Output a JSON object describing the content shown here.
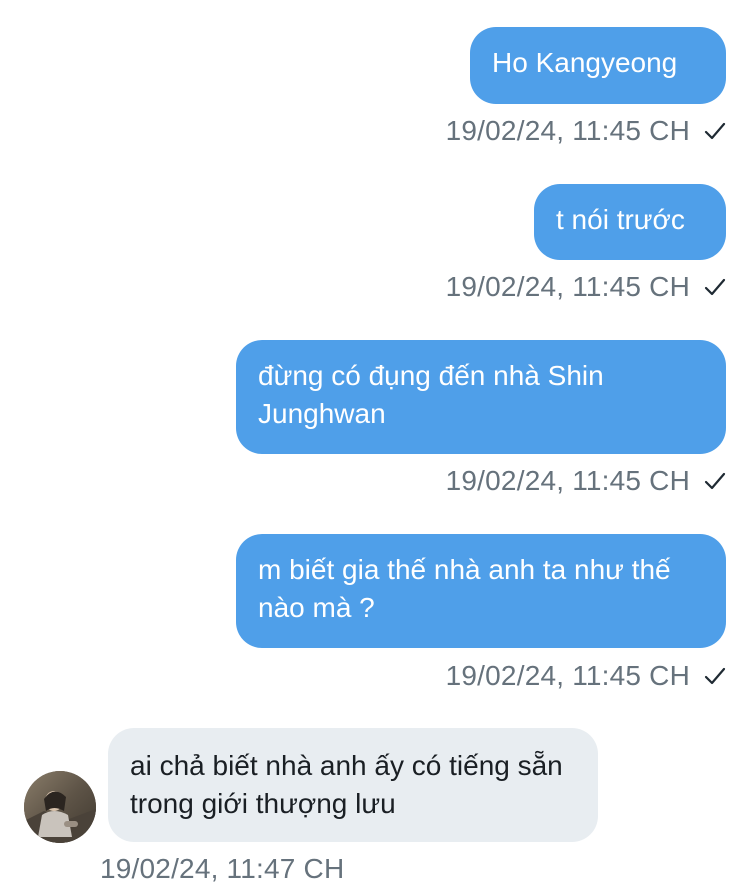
{
  "messages": [
    {
      "direction": "outgoing",
      "text": "Ho Kangyeong",
      "timestamp": "19/02/24, 11:45 CH",
      "status_icon": "check-icon"
    },
    {
      "direction": "outgoing",
      "text": "t nói trước",
      "timestamp": "19/02/24, 11:45 CH",
      "status_icon": "check-icon"
    },
    {
      "direction": "outgoing",
      "text": "đừng có đụng đến nhà Shin Junghwan",
      "timestamp": "19/02/24, 11:45 CH",
      "status_icon": "check-icon"
    },
    {
      "direction": "outgoing",
      "text": "m biết gia thế nhà anh ta như thế nào mà ?",
      "timestamp": "19/02/24, 11:45 CH",
      "status_icon": "check-icon"
    },
    {
      "direction": "incoming",
      "text": "ai chả biết nhà anh ấy có tiếng sẵn trong giới thượng lưu",
      "timestamp": "19/02/24, 11:47 CH",
      "avatar": "user-avatar"
    }
  ],
  "colors": {
    "outgoing_bubble": "#4f9fe9",
    "incoming_bubble": "#e8edf1",
    "timestamp_text": "#66727c",
    "background": "#ffffff"
  }
}
